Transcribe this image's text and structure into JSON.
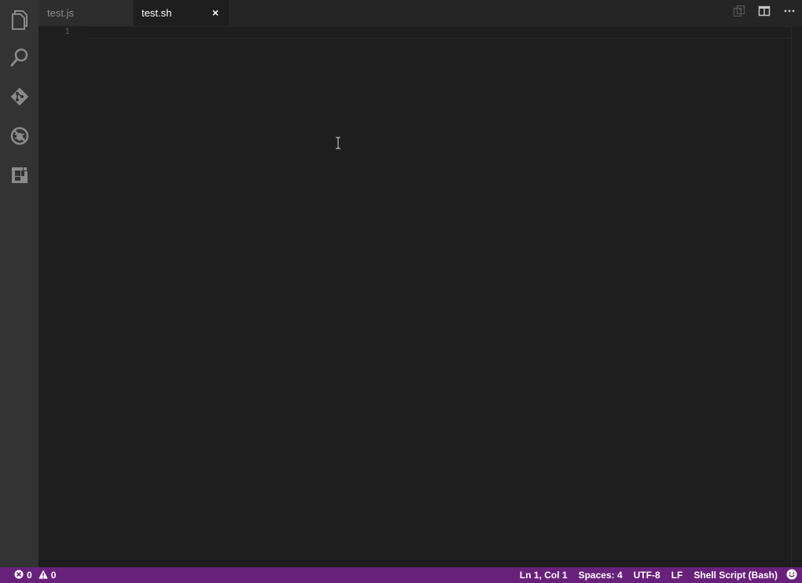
{
  "tabs": [
    {
      "label": "test.js",
      "active": false
    },
    {
      "label": "test.sh",
      "active": true
    }
  ],
  "tab_close_glyph": "×",
  "activity_bar": [
    {
      "icon": "files-icon"
    },
    {
      "icon": "search-icon"
    },
    {
      "icon": "source-control-icon"
    },
    {
      "icon": "debug-icon"
    },
    {
      "icon": "extensions-icon"
    }
  ],
  "editor": {
    "line_numbers": [
      "1"
    ]
  },
  "status_bar": {
    "errors": "0",
    "warnings": "0",
    "position": "Ln 1, Col 1",
    "indentation": "Spaces: 4",
    "encoding": "UTF-8",
    "eol": "LF",
    "language": "Shell Script (Bash)"
  },
  "colors": {
    "status_bar": "#68217a",
    "activity_bar": "#333333",
    "editor_bg": "#1e1e1e",
    "tab_bar": "#252526"
  }
}
